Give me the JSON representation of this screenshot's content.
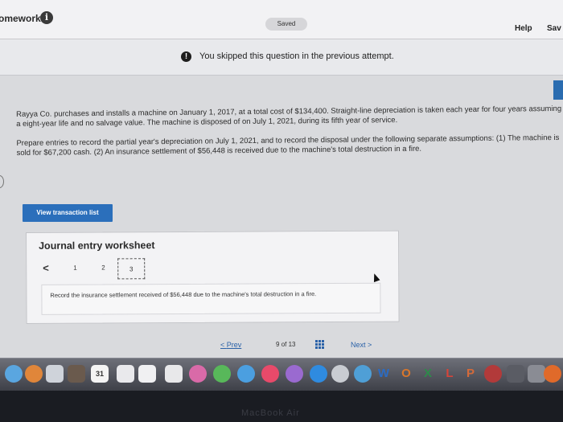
{
  "header": {
    "title": "omework",
    "saved_label": "Saved",
    "help_label": "Help",
    "save_label": "Sav"
  },
  "banner": {
    "message": "You skipped this question in the previous attempt."
  },
  "question": {
    "paragraph1": "Rayya Co. purchases and installs a machine on January 1, 2017, at a total cost of $134,400. Straight-line depreciation is taken each year for four years assuming a eight-year life and no salvage value. The machine is disposed of on July 1, 2021, during its fifth year of service.",
    "paragraph2": "Prepare entries to record the partial year's depreciation on July 1, 2021, and to record the disposal under the following separate assumptions: (1) The machine is sold for $67,200 cash. (2) An insurance settlement of $56,448 is received due to the machine's total destruction in a fire."
  },
  "view_transactions_label": "View transaction list",
  "worksheet": {
    "title": "Journal entry worksheet",
    "back_glyph": "<",
    "steps": [
      "1",
      "2",
      "3"
    ],
    "instruction": "Record the insurance settlement received of $56,448 due to the machine's total destruction in a fire."
  },
  "pagination": {
    "prev_label": "Prev",
    "current": "9",
    "of_label": "of",
    "total": "13",
    "next_label": "Next"
  },
  "dock": {
    "calendar_day": "31",
    "letters": [
      "W",
      "O",
      "X",
      "L",
      "P"
    ]
  },
  "bezel": "MacBook Air"
}
